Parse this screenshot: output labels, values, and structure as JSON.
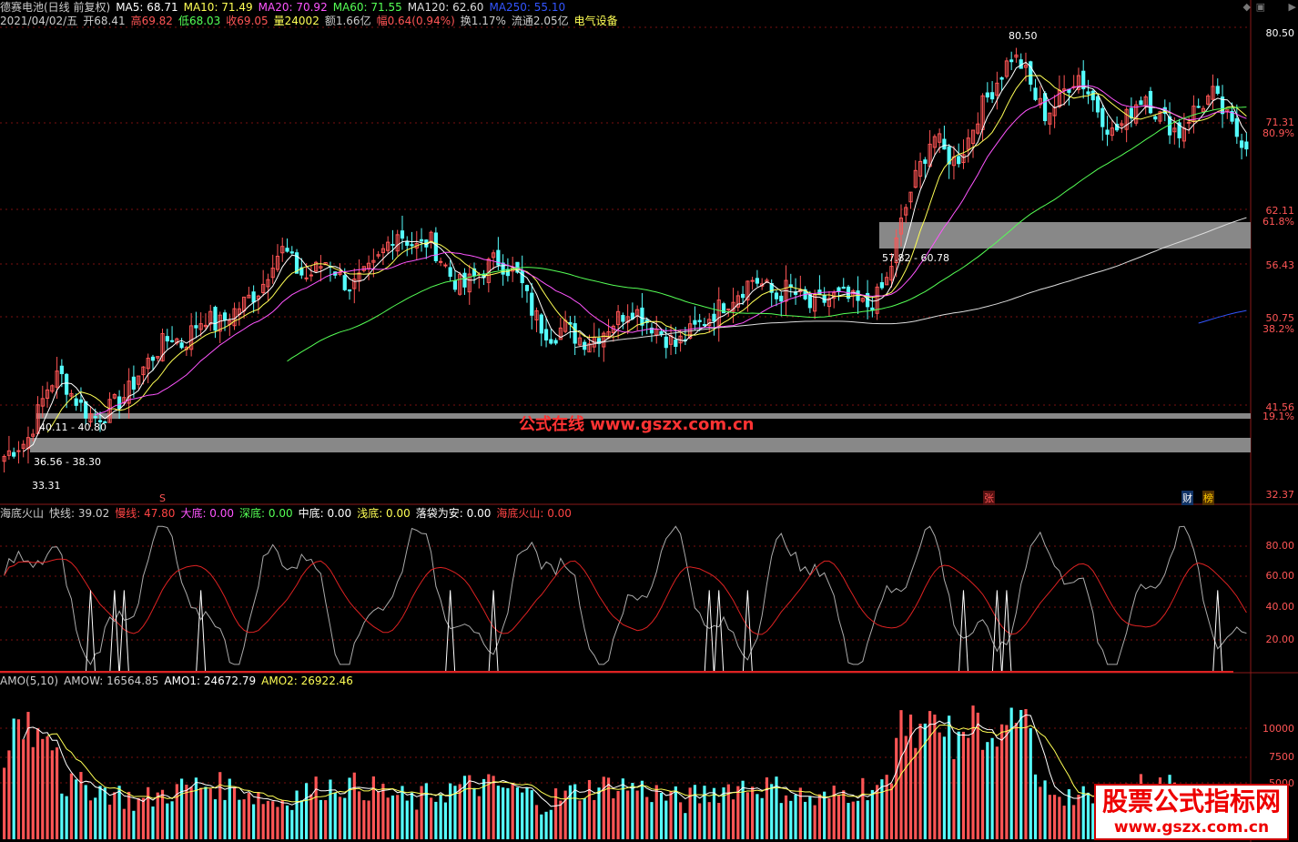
{
  "header": {
    "line1": [
      {
        "text": "德赛电池(日线 前复权)",
        "color": "#cccccc"
      },
      {
        "text": "MA5: 68.71",
        "color": "#ffffff"
      },
      {
        "text": "MA10: 71.49",
        "color": "#ffff55"
      },
      {
        "text": "MA20: 70.92",
        "color": "#ff55ff"
      },
      {
        "text": "MA60: 71.55",
        "color": "#55ff55"
      },
      {
        "text": "MA120: 62.60",
        "color": "#dddddd"
      },
      {
        "text": "MA250: 55.10",
        "color": "#3355ff"
      }
    ],
    "line2": [
      {
        "text": "2021/04/02/五",
        "color": "#cccccc"
      },
      {
        "text": "开68.41",
        "color": "#cccccc"
      },
      {
        "text": "高69.82",
        "color": "#ff5555"
      },
      {
        "text": "低68.03",
        "color": "#55ff55"
      },
      {
        "text": "收69.05",
        "color": "#ff5555"
      },
      {
        "text": "量24002",
        "color": "#ffff55"
      },
      {
        "text": "额1.66亿",
        "color": "#cccccc"
      },
      {
        "text": "幅0.64(0.94%)",
        "color": "#ff5555"
      },
      {
        "text": "换1.17%",
        "color": "#cccccc"
      },
      {
        "text": "流通2.05亿",
        "color": "#cccccc"
      },
      {
        "text": "电气设备",
        "color": "#ffff55"
      }
    ],
    "ind1": [
      {
        "text": "海底火山",
        "color": "#cccccc"
      },
      {
        "text": "快线: 39.02",
        "color": "#cccccc"
      },
      {
        "text": "慢线: 47.80",
        "color": "#ff4444"
      },
      {
        "text": "大底: 0.00",
        "color": "#ff55ff"
      },
      {
        "text": "深底: 0.00",
        "color": "#55ff55"
      },
      {
        "text": "中底: 0.00",
        "color": "#ffffff"
      },
      {
        "text": "浅底: 0.00",
        "color": "#ffff55"
      },
      {
        "text": "落袋为安: 0.00",
        "color": "#ffffff"
      },
      {
        "text": "海底火山: 0.00",
        "color": "#ff4444"
      }
    ],
    "ind2": [
      {
        "text": "AMO(5,10)",
        "color": "#cccccc"
      },
      {
        "text": "AMOW: 16564.85",
        "color": "#cccccc"
      },
      {
        "text": "AMO1: 24672.79",
        "color": "#ffffff"
      },
      {
        "text": "AMO2: 26922.46",
        "color": "#ffff55"
      }
    ]
  },
  "price_axis": [
    {
      "label": "80.50",
      "color": "#ffffff"
    },
    {
      "label": "71.31",
      "color": "#ff5555"
    },
    {
      "label": "80.9%",
      "color": "#ff5555"
    },
    {
      "label": "62.11",
      "color": "#ff5555"
    },
    {
      "label": "61.8%",
      "color": "#ff5555"
    },
    {
      "label": "56.43",
      "color": "#ff5555"
    },
    {
      "label": "50.75",
      "color": "#ff5555"
    },
    {
      "label": "38.2%",
      "color": "#ff5555"
    },
    {
      "label": "41.56",
      "color": "#ff5555"
    },
    {
      "label": "19.1%",
      "color": "#ff5555"
    },
    {
      "label": "32.37",
      "color": "#ff5555"
    }
  ],
  "ind1_axis": [
    "80.00",
    "60.00",
    "40.00",
    "20.00"
  ],
  "ind2_axis": [
    "10000",
    "7500",
    "5000"
  ],
  "annotations": {
    "high": "80.50",
    "low": "33.31",
    "zone1": "36.56 - 38.30",
    "zone2": "40.11 - 40.80",
    "zone3": "57.82 - 60.78",
    "marker_s": "S",
    "marker_zhang": "张",
    "marker_cai": "财",
    "marker_bang": "榜"
  },
  "watermark": {
    "text": "公式在线  www.gszx.com.cn"
  },
  "badge": {
    "line1": "股票公式指标网",
    "line2": "www.gszx.com.cn"
  },
  "colors": {
    "up": "#ff5555",
    "down": "#55ffff",
    "zone": "#888888",
    "grid": "#7a1010"
  },
  "chart_data": [
    {
      "type": "candlestick",
      "title": "德赛电池(日线 前复权)",
      "ylim": [
        32.37,
        80.5
      ],
      "series": [
        {
          "name": "MA5",
          "last": 68.71
        },
        {
          "name": "MA10",
          "last": 71.49
        },
        {
          "name": "MA20",
          "last": 70.92
        },
        {
          "name": "MA60",
          "last": 71.55
        },
        {
          "name": "MA120",
          "last": 62.6
        },
        {
          "name": "MA250",
          "last": 55.1
        }
      ],
      "close_anchors": [
        36.5,
        37.5,
        38,
        41,
        44,
        45,
        43,
        41.5,
        40.5,
        41,
        42,
        43,
        45,
        46.5,
        48,
        49,
        48,
        50,
        51,
        50,
        51,
        52,
        53,
        54,
        57,
        58,
        56,
        55,
        56,
        57,
        55,
        54,
        55,
        56,
        58,
        60,
        59,
        58,
        59,
        57,
        55,
        54,
        55,
        56,
        57,
        56,
        55,
        52,
        50,
        49,
        50,
        49,
        48.5,
        49,
        50,
        51,
        52,
        51,
        50,
        49,
        48,
        49,
        50,
        51,
        52,
        53,
        54,
        55,
        54,
        53,
        54,
        53,
        52,
        52.5,
        53,
        53,
        52.5,
        52,
        53,
        55,
        60,
        64,
        67,
        70,
        68,
        67,
        69,
        72,
        74,
        76,
        78,
        77,
        74,
        72,
        73,
        75,
        76,
        74,
        72,
        70,
        71,
        73,
        74,
        72,
        71,
        70,
        72,
        73,
        74,
        72,
        70,
        69
      ]
    },
    {
      "type": "line",
      "title": "海底火山",
      "ylim": [
        0,
        100
      ],
      "series": [
        {
          "name": "快线",
          "last": 39.02
        },
        {
          "name": "慢线",
          "last": 47.8
        },
        {
          "name": "大底",
          "last": 0.0
        },
        {
          "name": "深底",
          "last": 0.0
        },
        {
          "name": "中底",
          "last": 0.0
        },
        {
          "name": "浅底",
          "last": 0.0
        },
        {
          "name": "落袋为安",
          "last": 0.0
        },
        {
          "name": "海底火山",
          "last": 0.0
        }
      ]
    },
    {
      "type": "bar",
      "title": "AMO(5,10)",
      "series": [
        {
          "name": "AMOW",
          "last": 16564.85
        },
        {
          "name": "AMO1",
          "last": 24672.79
        },
        {
          "name": "AMO2",
          "last": 26922.46
        }
      ]
    }
  ]
}
